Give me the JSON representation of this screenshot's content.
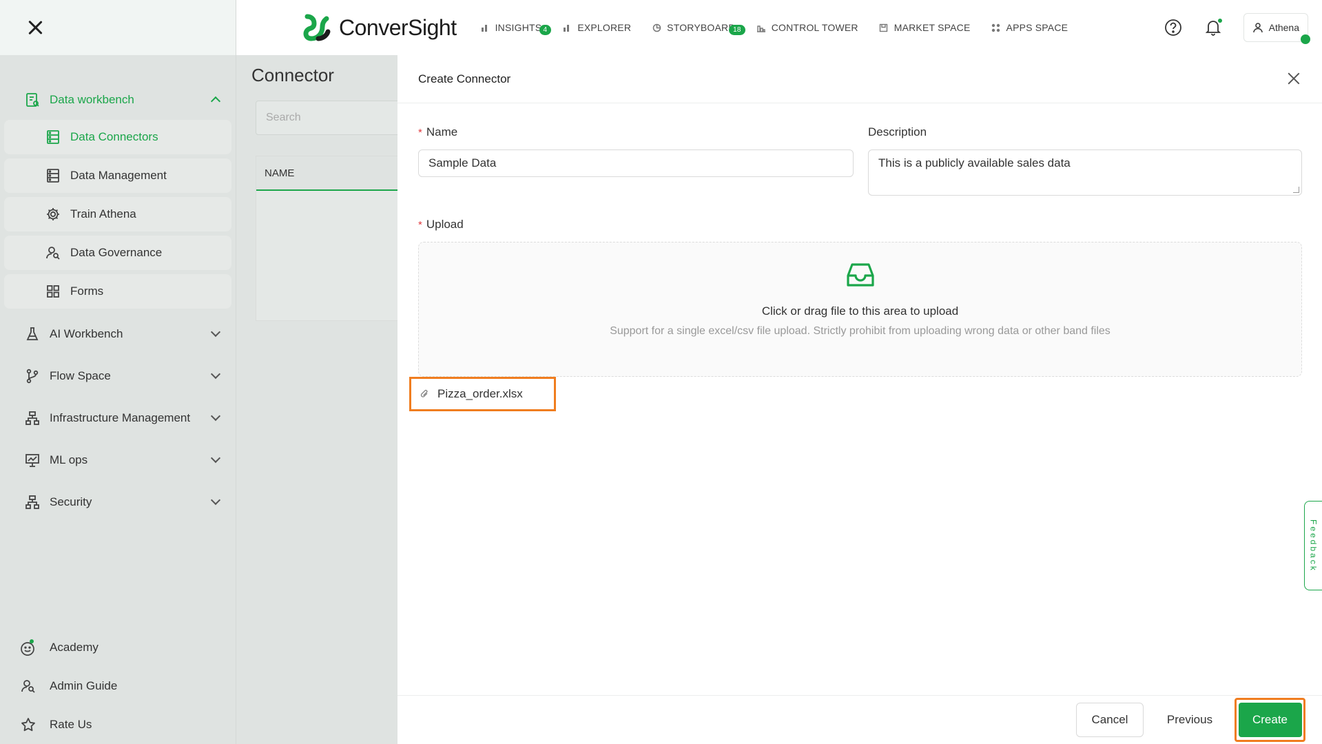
{
  "sidebar": {
    "group": {
      "label": "Data workbench"
    },
    "sub_items": [
      {
        "label": "Data Connectors"
      },
      {
        "label": "Data Management"
      },
      {
        "label": "Train Athena"
      },
      {
        "label": "Data Governance"
      },
      {
        "label": "Forms"
      }
    ],
    "items": [
      {
        "label": "AI Workbench"
      },
      {
        "label": "Flow Space"
      },
      {
        "label": "Infrastructure Management"
      },
      {
        "label": "ML ops"
      },
      {
        "label": "Security"
      }
    ],
    "bottom": [
      {
        "label": "Academy"
      },
      {
        "label": "Admin Guide"
      },
      {
        "label": "Rate Us"
      }
    ]
  },
  "header": {
    "brand": "ConverSight",
    "nav": [
      {
        "label": "INSIGHTS",
        "badge": "4"
      },
      {
        "label": "EXPLORER"
      },
      {
        "label": "STORYBOARD",
        "badge": "18"
      },
      {
        "label": "CONTROL TOWER"
      },
      {
        "label": "MARKET SPACE"
      },
      {
        "label": "APPS SPACE"
      }
    ],
    "user": "Athena"
  },
  "background_page": {
    "title": "Connector",
    "search_placeholder": "Search",
    "column_name": "NAME"
  },
  "drawer": {
    "title": "Create Connector",
    "name_label": "Name",
    "name_value": "Sample Data",
    "description_label": "Description",
    "description_value": "This is a publicly available sales data",
    "upload_label": "Upload",
    "upload_title": "Click or drag file to this area to upload",
    "upload_hint": "Support for a single excel/csv file upload. Strictly prohibit from uploading wrong data or other band files",
    "file_name": "Pizza_order.xlsx",
    "feedback": "Feedback",
    "cancel_label": "Cancel",
    "previous_label": "Previous",
    "create_label": "Create"
  },
  "colors": {
    "accent": "#1ba64a",
    "highlight": "#f07d1f",
    "required": "#e0393e"
  }
}
